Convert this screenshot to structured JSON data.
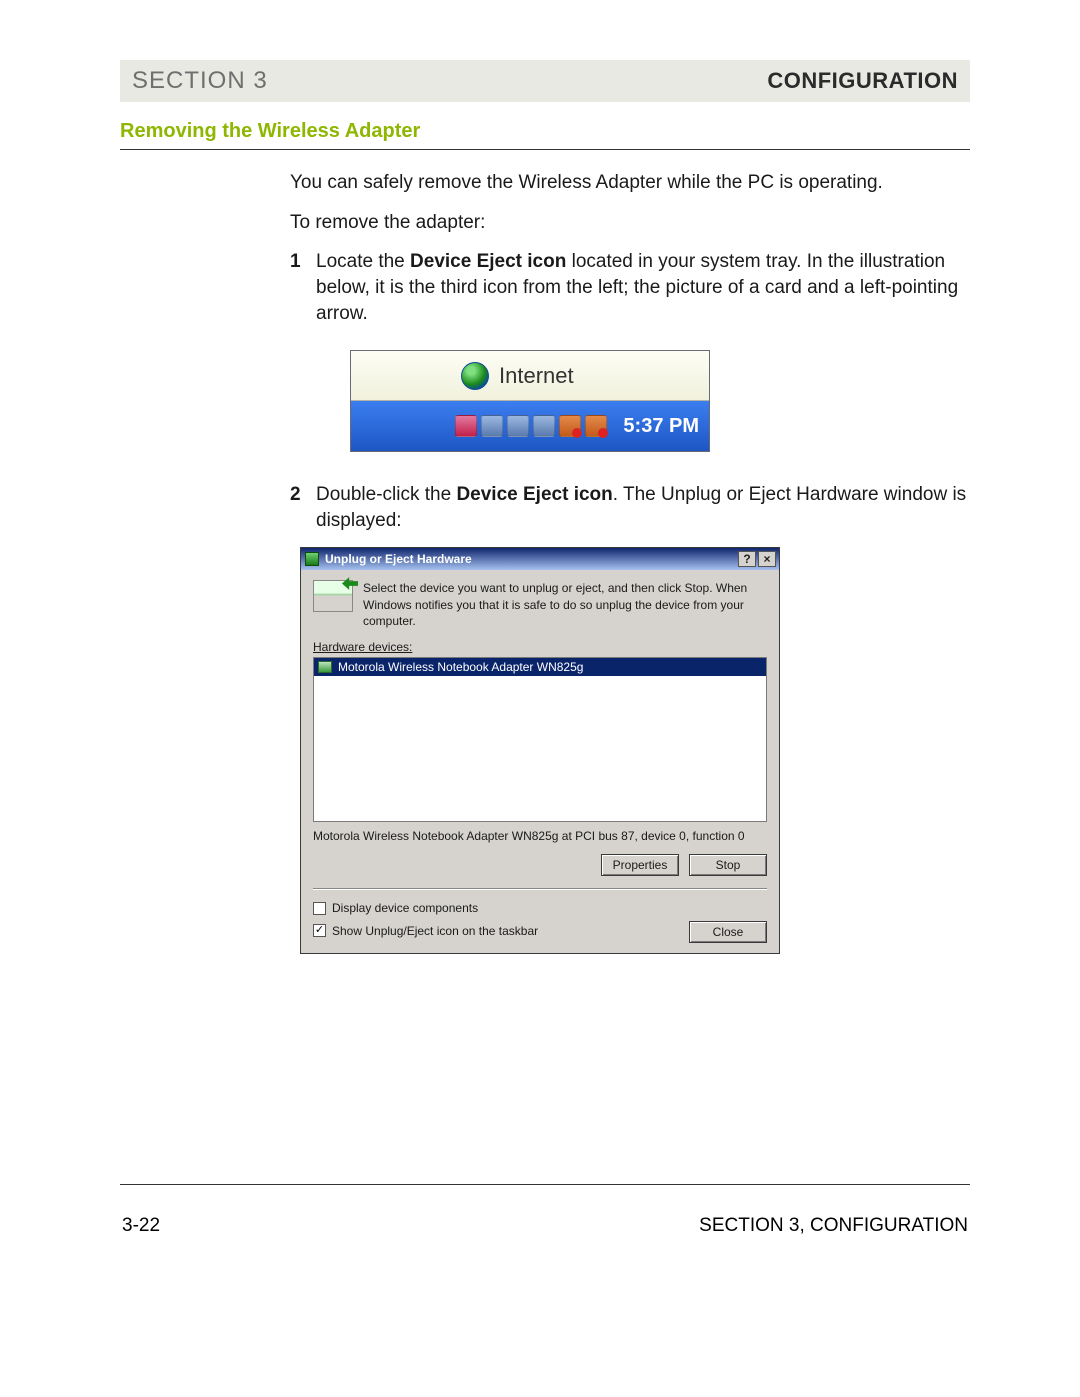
{
  "header": {
    "section": "SECTION 3",
    "title": "CONFIGURATION"
  },
  "subheading": "Removing the Wireless Adapter",
  "intro": "You can safely remove the Wireless Adapter while the PC is operating.",
  "lead": "To remove the adapter:",
  "steps": {
    "s1": {
      "num": "1",
      "b": "Device Eject icon",
      "pre": "Locate the ",
      "post": " located in your system tray. In the illustration below, it is the third icon from the left; the picture of a card and a left-pointing arrow."
    },
    "s2": {
      "num": "2",
      "b": "Device Eject icon",
      "pre": "Double-click the ",
      "post": ". The Unplug or Eject Hardware window is displayed:"
    }
  },
  "tray": {
    "label": "Internet",
    "time": "5:37 PM"
  },
  "dialog": {
    "title": "Unplug or Eject Hardware",
    "help": "?",
    "close": "×",
    "instruction": "Select the device you want to unplug or eject, and then click Stop. When Windows notifies you that it is safe to do so unplug the device from your computer.",
    "hw_label": "Hardware devices:",
    "item": "Motorola Wireless Notebook Adapter WN825g",
    "description": "Motorola Wireless Notebook Adapter WN825g at PCI bus 87, device 0, function 0",
    "btn_properties": "Properties",
    "btn_stop": "Stop",
    "chk_components": "Display device components",
    "chk_taskbar": "Show Unplug/Eject icon on the taskbar",
    "btn_close": "Close",
    "check": "✓"
  },
  "footer": {
    "page": "3-22",
    "label": "SECTION 3, CONFIGURATION"
  }
}
